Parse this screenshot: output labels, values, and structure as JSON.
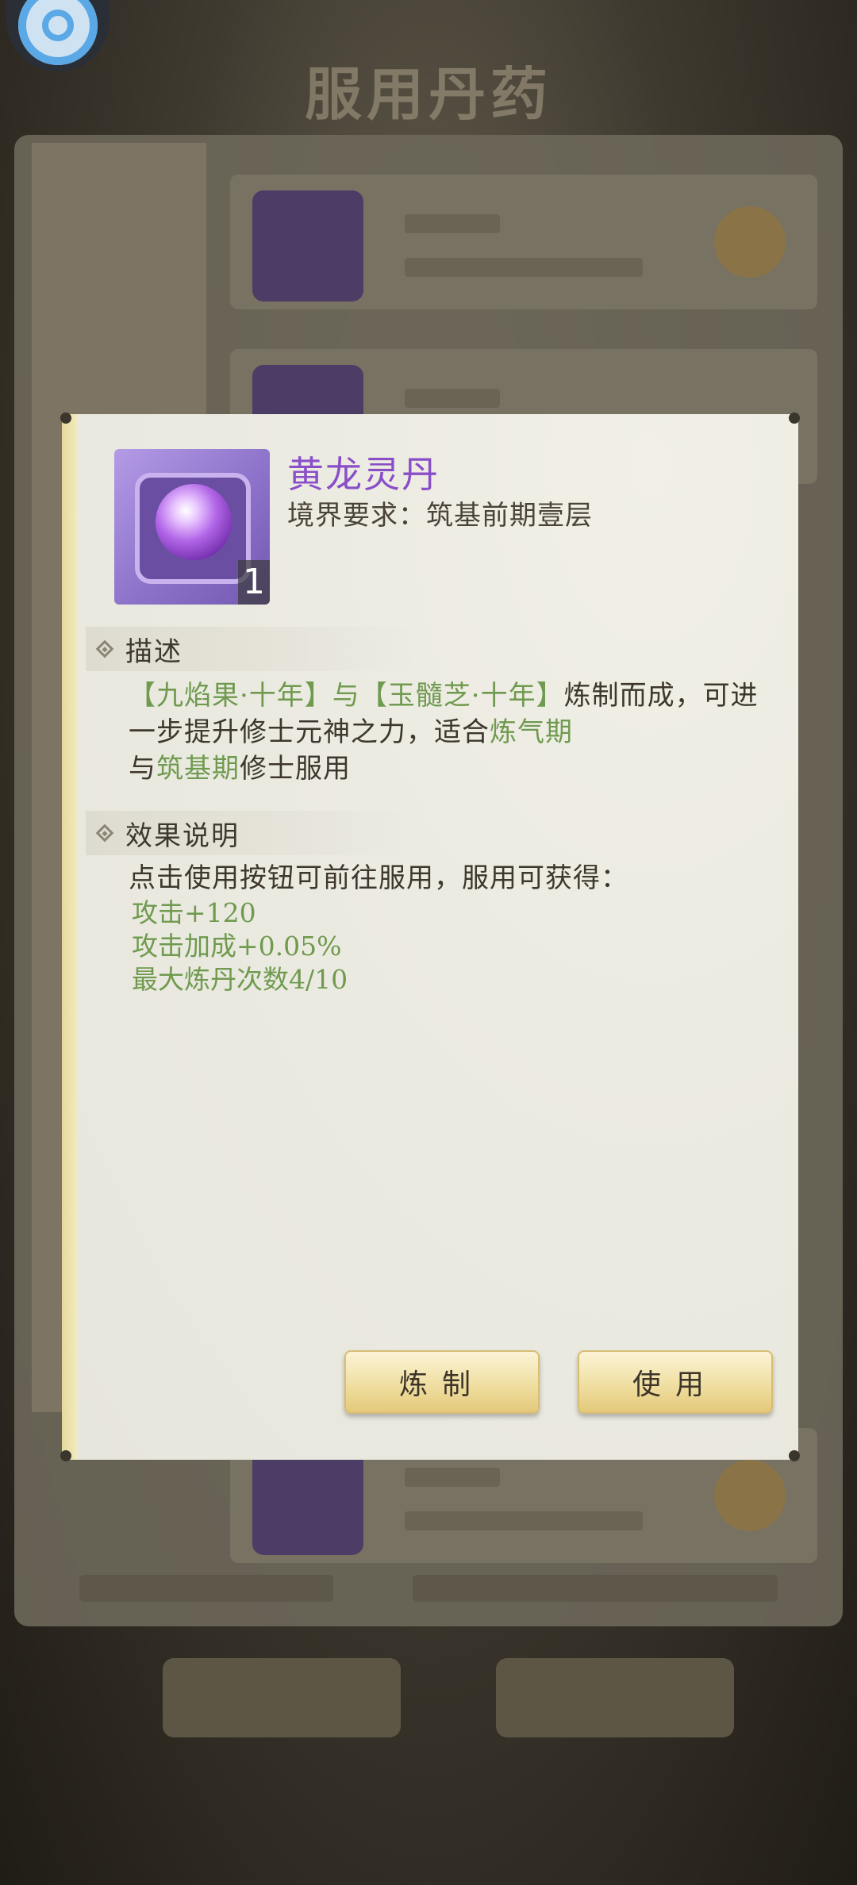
{
  "background": {
    "screen_title": "服用丹药",
    "tabs": [
      "",
      "",
      ""
    ]
  },
  "dialog": {
    "item": {
      "name": "黄龙灵丹",
      "requirement": "境界要求：筑基前期壹层",
      "count": "1"
    },
    "description": {
      "heading": "描述",
      "segments": [
        {
          "text": "【九焰果·十年】与【玉髓芝·十年】",
          "green": true
        },
        {
          "text": "炼制而成，可进一步提升修士元神之力，适合",
          "green": false
        },
        {
          "text": "炼气期",
          "green": true
        },
        {
          "text": "与",
          "green": false
        },
        {
          "text": "筑基期",
          "green": true
        },
        {
          "text": "修士服用",
          "green": false
        }
      ]
    },
    "effects": {
      "heading": "效果说明",
      "intro": "点击使用按钮可前往服用，服用可获得：",
      "lines": [
        "攻击+120",
        "攻击加成+0.05%",
        "最大炼丹次数4/10"
      ]
    },
    "buttons": {
      "refine": "炼制",
      "use": "使用"
    }
  },
  "colors": {
    "title_purple": "#8a4fc8",
    "highlight_green": "#6f9a4f",
    "button_gold": "#f0dfa2"
  }
}
